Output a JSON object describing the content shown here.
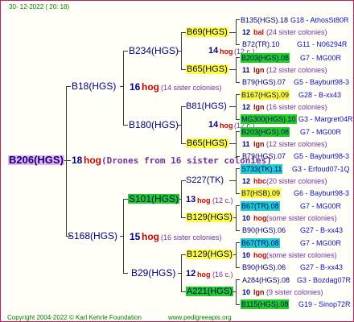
{
  "header": {
    "date": "30-  12-2022 (  20:  18)"
  },
  "root": {
    "name": "B206(HGS)",
    "num": "18",
    "word": "hog",
    "desc": "(Drones from 16 sister colonies)"
  },
  "father": {
    "name": "B18(HGS)",
    "num": "16",
    "word": "hog",
    "desc": "(14 sister colonies)"
  },
  "mother": {
    "name": "S168(HGS)",
    "num": "15",
    "word": "hog",
    "desc": "(16 sister colonies)"
  },
  "ff": {
    "name": "B234(HGS)"
  },
  "fm": {
    "name": "B180(HGS)"
  },
  "mf": {
    "name": "S101(HGS)",
    "num": "13",
    "word": "hog",
    "desc": "(12 c.)"
  },
  "mm": {
    "name": "B29(HGS)",
    "num": "12",
    "word": "hog",
    "desc": "(16 c.)"
  },
  "g3": [
    {
      "name": "B69(HGS)",
      "num": "14",
      "word": "hog",
      "desc": "(12 c.)"
    },
    {
      "name": "B65(HGS)"
    },
    {
      "name": "B81(HGS)",
      "num": "14",
      "word": "hog",
      "desc": "(12 c.)"
    },
    {
      "name": "B65(HGS)"
    },
    {
      "name": "S227(TK)",
      "num": "",
      "word": "",
      "desc": ""
    },
    {
      "name": "B129(HGS)"
    },
    {
      "name": "B129(HGS)",
      "num": "",
      "word": "",
      "desc": ""
    },
    {
      "name": "A221(HGS)"
    }
  ],
  "g4": [
    {
      "name": "B135(HGS).18",
      "code": "G18 - AthosSt80R"
    },
    {
      "num": "12",
      "word": "bal",
      "desc": "(24 sister colonies)"
    },
    {
      "name": "B72(TR).10",
      "code": "G11 - N06294R"
    },
    {
      "name": "B203(HGS).08",
      "code": "G7 - MG00R"
    },
    {
      "num": "11",
      "word": "lgn",
      "desc": "(12 sister colonies)"
    },
    {
      "name": "B79(HGS).07",
      "code": "G5 - Bayburt98-3"
    },
    {
      "name": "B167(HGS).09",
      "code": "G28 - B-xx43"
    },
    {
      "num": "12",
      "word": "lgn",
      "desc": "(16 sister colonies)"
    },
    {
      "name": "MG300(HGS).10",
      "code": "G3 - Margret04R"
    },
    {
      "name": "B203(HGS).08",
      "code": "G7 - MG00R"
    },
    {
      "num": "11",
      "word": "lgn",
      "desc": "(12 sister colonies)"
    },
    {
      "name": "B79(HGS).07",
      "code": "G5 - Bayburt98-3"
    },
    {
      "name": "S733(TK).11",
      "code": "G3 - Erfoud07-1Q"
    },
    {
      "num": "12",
      "word": "hbc",
      "desc": "(20 sister colonies)"
    },
    {
      "name": "B7(HSB).09",
      "code": "G6 - Bayburt98-3"
    },
    {
      "name": "B67(TR).08",
      "code": "G7 - MG00R"
    },
    {
      "num": "10",
      "word": "hog",
      "desc": "(some sister colonies)"
    },
    {
      "name": "B90(HGS).06",
      "code": "G27 - B-xx43"
    },
    {
      "name": "B67(TR).08",
      "code": "G7 - MG00R"
    },
    {
      "num": "10",
      "word": "hog",
      "desc": "(some sister colonies)"
    },
    {
      "name": "B90(HGS).06",
      "code": "G27 - B-xx43"
    },
    {
      "name": "A284(HGS).08",
      "code": "G3 - Bozdag07R"
    },
    {
      "num": "10",
      "word": "lgn",
      "desc": "(9 sister colonies)"
    },
    {
      "name": "B115(HGS).08",
      "code": "G19 - Sinop72R"
    }
  ],
  "footer": {
    "copyright": "Copyright 2004-2022 © Karl Kehrle Foundation",
    "url": "www.pedigreeapis.org"
  },
  "colors": {
    "hog": "#cc0000",
    "lgn": "#8b0000",
    "bal": "#cc0000",
    "hbc": "#cc0000",
    "yellow": "#ffff33",
    "green": "#22cc22",
    "cyan": "#22cccc",
    "pink": "#f0b0f0"
  }
}
